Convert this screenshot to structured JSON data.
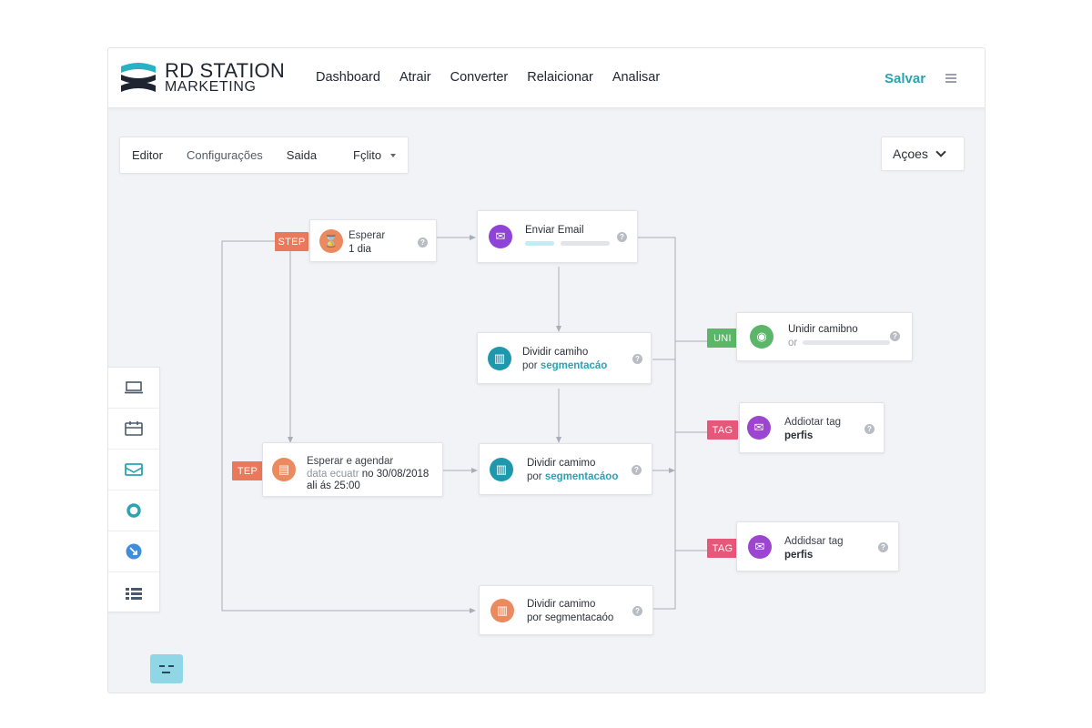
{
  "brand": {
    "line1": "RD STATION",
    "line2": "MARKETING"
  },
  "nav": [
    "Dashboard",
    "Atrair",
    "Converter",
    "Relaicionar",
    "Analisar"
  ],
  "header": {
    "save_label": "Salvar",
    "menu_icon": "hamburger-icon"
  },
  "tabs": {
    "editor": "Editor",
    "config": "Configurações",
    "saida": "Saida",
    "selected": "Fçlito"
  },
  "actions_label": "Açoes",
  "toolbox": [
    "monitor-icon",
    "calendar-icon",
    "email-icon",
    "circle-icon",
    "arrow-icon",
    "grid-icon"
  ],
  "badges": {
    "step1": "STEP",
    "step2": "TEP",
    "uni": "UNI",
    "tag1": "TAG",
    "tag2": "TAG"
  },
  "nodes": {
    "wait": {
      "title": "Esperar",
      "sub": "1 dia"
    },
    "email": {
      "title": "Enviar Email"
    },
    "split1": {
      "line1": "Dividir camiho",
      "line2a": "por",
      "line2b": "segmentacáo"
    },
    "join": {
      "title": "Unidir camibno",
      "sub": "or"
    },
    "schedule": {
      "line1": "Esperar e agendar",
      "line2a": "data ecuatr",
      "line2b": "no 30/08/2018",
      "line3": "ali ás 25:00"
    },
    "split2": {
      "line1": "Dividir camimo",
      "line2a": "por",
      "line2b": "segmentacáoo"
    },
    "tag1": {
      "line1": "Addiotar tag",
      "line2": "perfis"
    },
    "tag2": {
      "line1": "Addidsar tag",
      "line2": "perfis"
    },
    "split3": {
      "line1": "Dividir camimo",
      "line2": "por segmentacaóo"
    }
  },
  "colors": {
    "accent": "#2aa3b5",
    "step": "#e8795a",
    "uni": "#5cb66a",
    "tag": "#e5587a",
    "purple": "#8e44d6",
    "teal": "#1f98ad",
    "orange": "#ea8a5e"
  }
}
